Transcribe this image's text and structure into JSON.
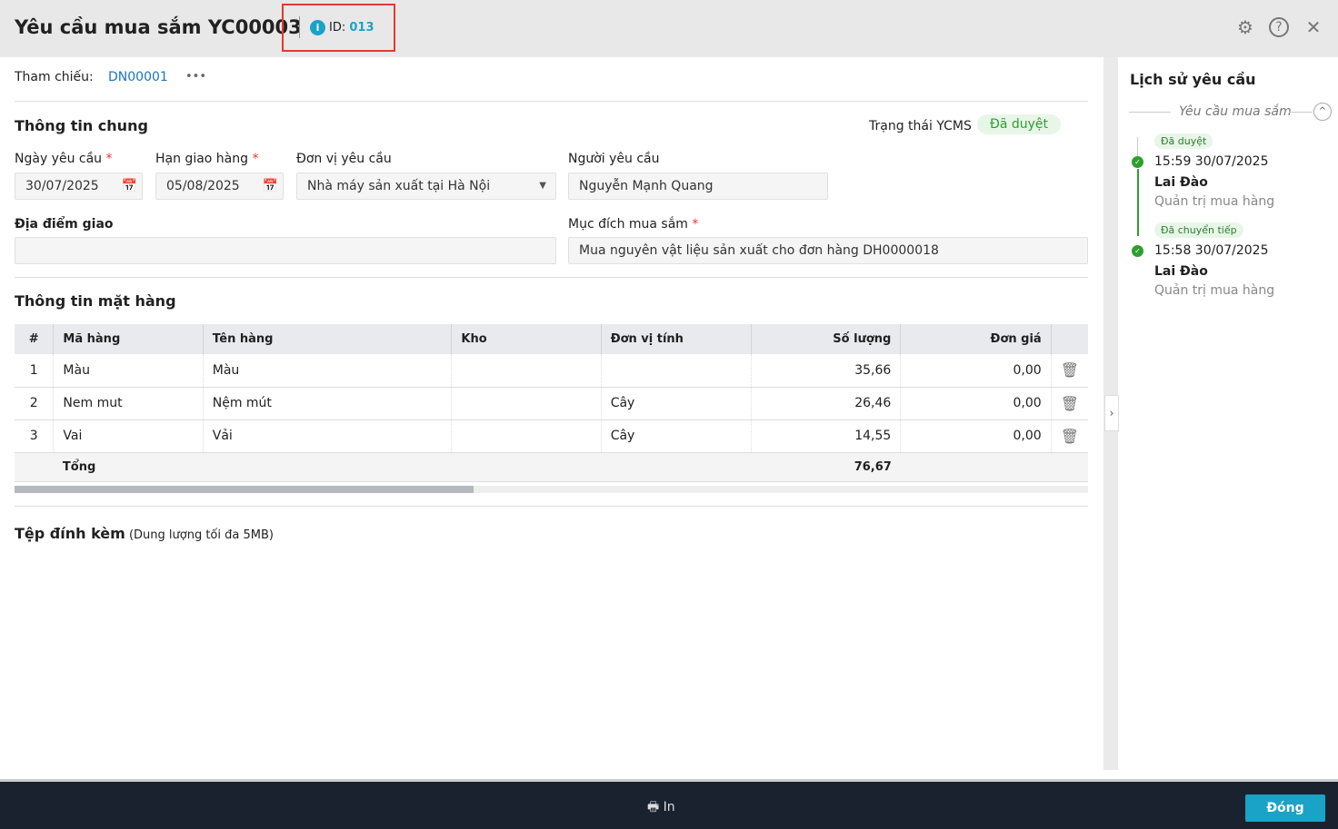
{
  "header": {
    "title": "Yêu cầu mua sắm YC00003",
    "id_label": "ID:",
    "id_value": "013"
  },
  "ref": {
    "label": "Tham chiếu:",
    "value": "DN00001",
    "more": "•••"
  },
  "general": {
    "title": "Thông tin chung",
    "status_label": "Trạng thái YCMS",
    "status_value": "Đã duyệt",
    "request_date_label": "Ngày yêu cầu",
    "request_date": "30/07/2025",
    "due_date_label": "Hạn giao hàng",
    "due_date": "05/08/2025",
    "unit_label": "Đơn vị yêu cầu",
    "unit": "Nhà máy sản xuất tại Hà Nội",
    "requester_label": "Người yêu cầu",
    "requester": "Nguyễn Mạnh Quang",
    "location_label": "Địa điểm giao",
    "location": "",
    "purpose_label": "Mục đích mua sắm",
    "purpose": "Mua nguyên vật liệu sản xuất cho đơn hàng DH0000018"
  },
  "items": {
    "title": "Thông tin mặt hàng",
    "columns": [
      "#",
      "Mã hàng",
      "Tên hàng",
      "Kho",
      "Đơn vị tính",
      "Số lượng",
      "Đơn giá"
    ],
    "rows": [
      [
        "1",
        "Màu",
        "Màu",
        "",
        "",
        "35,66",
        "0,00"
      ],
      [
        "2",
        "Nem mut",
        "Nệm mút",
        "",
        "Cây",
        "26,46",
        "0,00"
      ],
      [
        "3",
        "Vai",
        "Vải",
        "",
        "Cây",
        "14,55",
        "0,00"
      ]
    ],
    "total_label": "Tổng",
    "total_qty": "76,67"
  },
  "attach": {
    "title": "Tệp đính kèm",
    "note": "(Dung lượng tối đa 5MB)"
  },
  "history": {
    "title": "Lịch sử yêu cầu",
    "group": "Yêu cầu mua sắm",
    "entries": [
      {
        "tag": "Đã duyệt",
        "time": "15:59 30/07/2025",
        "name": "Lai Đào",
        "role": "Quản trị mua hàng"
      },
      {
        "tag": "Đã chuyển tiếp",
        "time": "15:58 30/07/2025",
        "name": "Lai Đào",
        "role": "Quản trị mua hàng"
      }
    ]
  },
  "footer": {
    "print": "In",
    "close": "Đóng"
  }
}
